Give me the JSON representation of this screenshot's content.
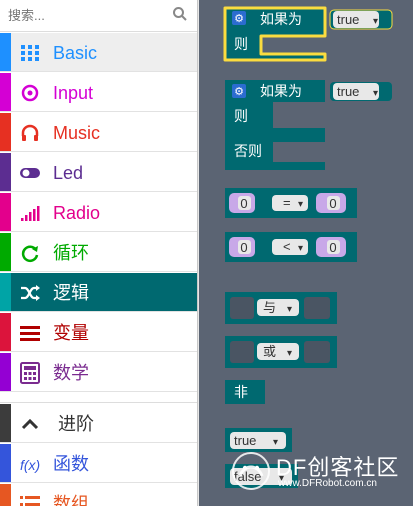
{
  "search": {
    "placeholder": "搜索..."
  },
  "categories": [
    {
      "label": "Basic",
      "color": "#1e90ff",
      "icon": "grid-icon"
    },
    {
      "label": "Input",
      "color": "#d400d4",
      "icon": "target-icon"
    },
    {
      "label": "Music",
      "color": "#e63022",
      "icon": "headphones-icon"
    },
    {
      "label": "Led",
      "color": "#5c2d91",
      "icon": "toggle-icon"
    },
    {
      "label": "Radio",
      "color": "#e3008c",
      "icon": "signal-bars-icon"
    },
    {
      "label": "循环",
      "color": "#00aa00",
      "icon": "refresh-icon"
    },
    {
      "label": "逻辑",
      "color": "#00a4a6",
      "icon": "shuffle-icon",
      "selected": true
    },
    {
      "label": "变量",
      "color": "#dc143c",
      "icon": "list-lines-icon"
    },
    {
      "label": "数学",
      "color": "#9400d3",
      "icon": "calculator-icon"
    }
  ],
  "advanced": [
    {
      "label": "进阶",
      "color": "#3c3c3c",
      "icon": "chevron-up-icon"
    },
    {
      "label": "函数",
      "color": "#3455db",
      "icon": "function-icon"
    },
    {
      "label": "数组",
      "color": "#e65722",
      "icon": "list-icon"
    }
  ],
  "blocks": {
    "if1": {
      "if_label": "如果为",
      "then_label": "则",
      "value": "true"
    },
    "if2": {
      "if_label": "如果为",
      "then_label": "则",
      "else_label": "否则",
      "value": "true"
    },
    "compare1": {
      "left": "0",
      "op": "=",
      "right": "0"
    },
    "compare2": {
      "left": "0",
      "op": "<",
      "right": "0"
    },
    "and": {
      "label": "与"
    },
    "or": {
      "label": "或"
    },
    "not": {
      "label": "非"
    },
    "true": {
      "label": "true"
    },
    "false": {
      "label": "false"
    }
  },
  "dropdown_arrow": "▾",
  "watermark": {
    "title": "DF创客社区",
    "url": "www.DFRobot.com.cn"
  },
  "colors": {
    "logic": "#006970",
    "highlight": "#fbdc3f",
    "flyout": "#5b6473",
    "value_block": "#c8a8e8"
  }
}
